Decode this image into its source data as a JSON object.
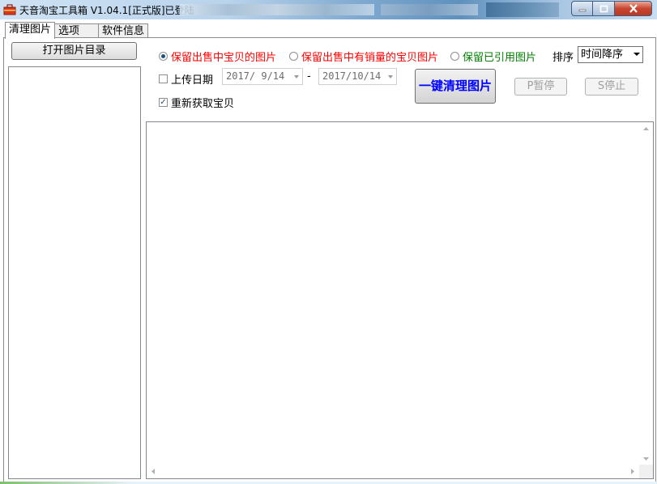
{
  "window": {
    "title": "天音淘宝工具箱 V1.04.1[正式版]已登陆",
    "controls": {
      "minimize": "−",
      "maximize": "□",
      "close": "✕"
    }
  },
  "tabs": [
    {
      "label": "清理图片",
      "active": true
    },
    {
      "label": "选项",
      "active": false
    },
    {
      "label": "软件信息",
      "active": false
    }
  ],
  "left": {
    "open_dir_button": "打开图片目录"
  },
  "options": {
    "radio1": {
      "label": "保留出售中宝贝的图片",
      "checked": true,
      "color": "#ff0000"
    },
    "radio2": {
      "label": "保留出售中有销量的宝贝图片",
      "checked": false,
      "color": "#ff0000"
    },
    "radio3": {
      "label": "保留已引用图片",
      "checked": false,
      "color": "#008000"
    },
    "sort_label": "排序",
    "sort_value": "时间降序",
    "upload_date_label": "上传日期",
    "upload_date_checked": false,
    "date_from": "2017/ 9/14",
    "date_sep": "-",
    "date_to": "2017/10/14",
    "refetch_label": "重新获取宝贝",
    "refetch_checked": true
  },
  "actions": {
    "clean_button": "一键清理图片",
    "pause_button": "P暂停",
    "stop_button": "S停止"
  },
  "icons": {
    "app": "toolbox-icon",
    "scroll_up": "arrow-up-icon",
    "scroll_down": "arrow-down-icon",
    "scroll_left": "arrow-left-icon",
    "scroll_right": "arrow-right-icon"
  }
}
